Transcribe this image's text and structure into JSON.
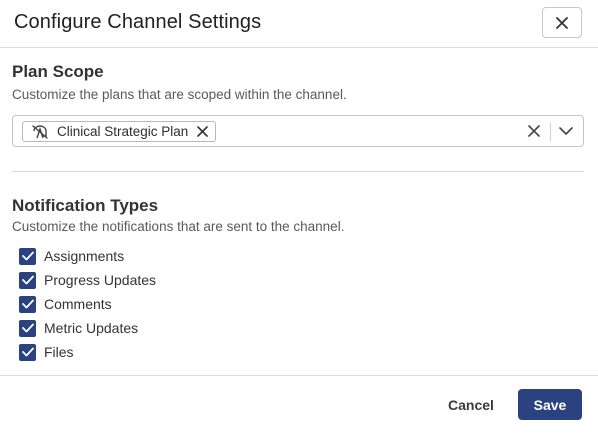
{
  "dialog": {
    "title": "Configure Channel Settings"
  },
  "plan_scope": {
    "title": "Plan Scope",
    "description": "Customize the plans that are scoped within the channel.",
    "selected_chips": [
      {
        "label": "Clinical Strategic Plan",
        "icon": "plan-no-sync-icon"
      }
    ]
  },
  "notification_types": {
    "title": "Notification Types",
    "description": "Customize the notifications that are sent to the channel.",
    "options": [
      {
        "label": "Assignments",
        "checked": true
      },
      {
        "label": "Progress Updates",
        "checked": true
      },
      {
        "label": "Comments",
        "checked": true
      },
      {
        "label": "Metric Updates",
        "checked": true
      },
      {
        "label": "Files",
        "checked": true
      }
    ]
  },
  "footer": {
    "cancel_label": "Cancel",
    "save_label": "Save"
  },
  "colors": {
    "primary": "#2a4380",
    "border": "#c4c4c4",
    "divider": "#d9d9d9"
  }
}
